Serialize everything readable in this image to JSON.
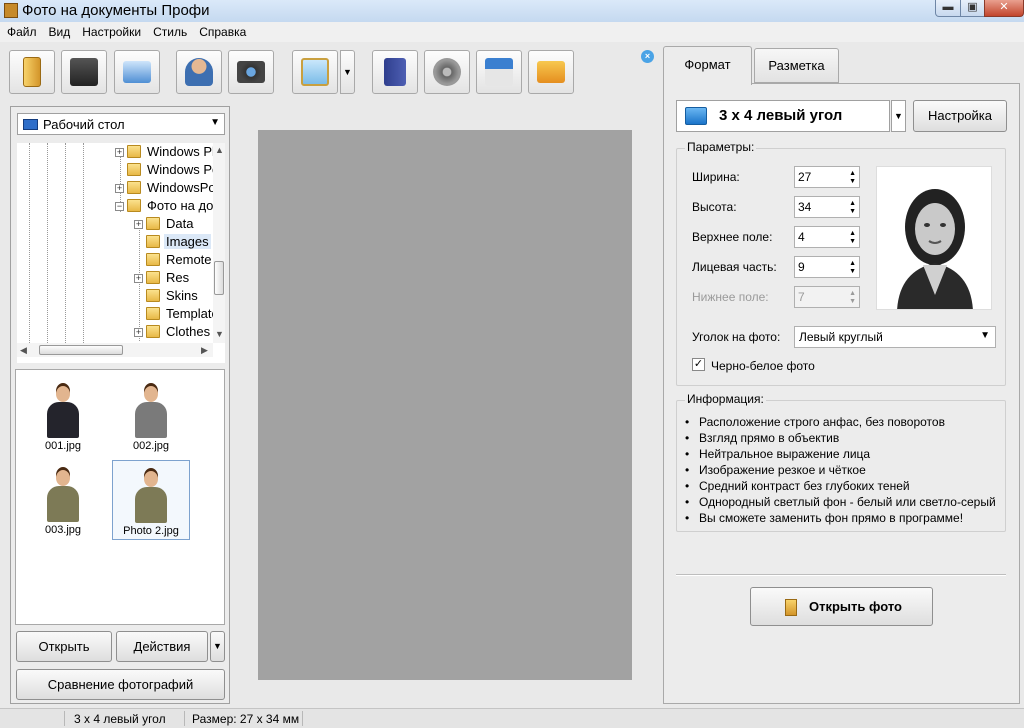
{
  "window": {
    "title": "Фото на документы Профи",
    "min_glyph": "▬",
    "max_glyph": "▣",
    "close_glyph": "✕"
  },
  "menu": [
    "Файл",
    "Вид",
    "Настройки",
    "Стиль",
    "Справка"
  ],
  "toolbar": {
    "icons": [
      "open-photo-icon",
      "save-icon",
      "print-icon",
      "user-profile-icon",
      "camera-icon",
      "image-editor-icon",
      "help-book-icon",
      "video-reel-icon",
      "home-icon",
      "shopping-cart-icon"
    ],
    "dropdown_glyph": "▼",
    "close_glyph": "×"
  },
  "left": {
    "folder": "Рабочий стол",
    "folder_arrow": "▼",
    "tree": [
      {
        "label": "Windows Ph",
        "expander": "+"
      },
      {
        "label": "Windows Po",
        "expander": ""
      },
      {
        "label": "WindowsPov",
        "expander": "+"
      },
      {
        "label": "Фото на док",
        "expander": "−"
      },
      {
        "label": "Data",
        "expander": "+"
      },
      {
        "label": "Images",
        "expander": "",
        "selected": true
      },
      {
        "label": "Remote",
        "expander": ""
      },
      {
        "label": "Res",
        "expander": "+"
      },
      {
        "label": "Skins",
        "expander": ""
      },
      {
        "label": "Template",
        "expander": ""
      },
      {
        "label": "Clothes",
        "expander": "+"
      }
    ],
    "scroll": {
      "up": "▲",
      "down": "▼",
      "left": "◀",
      "right": "▶"
    },
    "thumbnails": [
      {
        "name": "001.jpg",
        "outfit": "dark"
      },
      {
        "name": "002.jpg",
        "outfit": "gray"
      },
      {
        "name": "003.jpg",
        "outfit": "olive"
      },
      {
        "name": "Photo 2.jpg",
        "outfit": "olive",
        "selected": true
      }
    ],
    "open_label": "Открыть",
    "actions_label": "Действия",
    "actions_dd": "▼",
    "compare_label": "Сравнение фотографий"
  },
  "right": {
    "tabs": [
      "Формат",
      "Разметка"
    ],
    "format_value": "3 x 4 левый угол",
    "format_dd": "▼",
    "settings_label": "Настройка",
    "params_legend": "Параметры:",
    "params": [
      {
        "label": "Ширина:",
        "value": "27",
        "disabled": false
      },
      {
        "label": "Высота:",
        "value": "34",
        "disabled": false
      },
      {
        "label": "Верхнее поле:",
        "value": "4",
        "disabled": false
      },
      {
        "label": "Лицевая часть:",
        "value": "9",
        "disabled": false
      },
      {
        "label": "Нижнее поле:",
        "value": "7",
        "disabled": true
      }
    ],
    "spin_up": "▲",
    "spin_down": "▼",
    "corner_label": "Уголок на фото:",
    "corner_value": "Левый круглый",
    "corner_dd": "▼",
    "bw_label": "Черно-белое фото",
    "bw_checked": "✓",
    "info_legend": "Информация:",
    "info": [
      "Расположение строго анфас, без поворотов",
      "Взгляд прямо в объектив",
      "Нейтральное выражение лица",
      "Изображение резкое и чёткое",
      "Средний контраст без глубоких теней",
      "Однородный светлый фон - белый или светло-серый",
      "Вы сможете заменить фон прямо в программе!"
    ],
    "open_photo_label": "Открыть фото"
  },
  "status": {
    "format": "3 x 4 левый угол",
    "size": "Размер: 27 x 34 мм"
  },
  "colors": {
    "preview_bg": "#a2a2a2",
    "accent": "#4aa3e6"
  }
}
